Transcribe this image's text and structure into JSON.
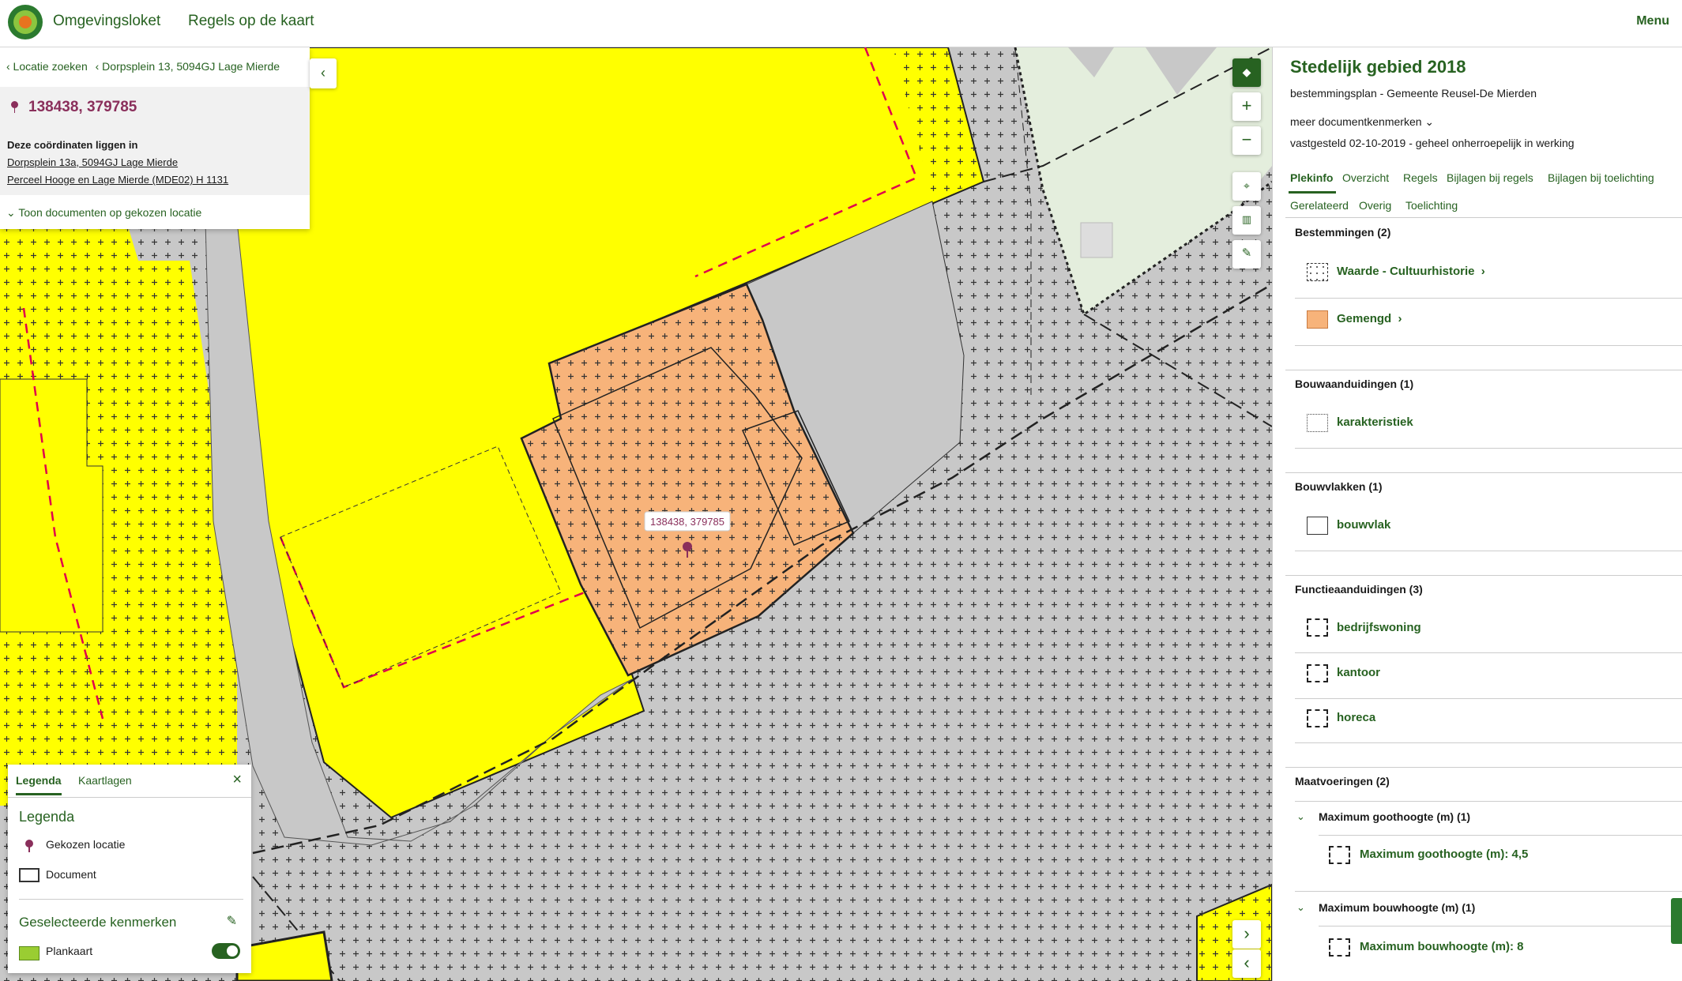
{
  "header": {
    "brand": "Omgevingsloket",
    "title": "Regels op de kaart",
    "menu": "Menu"
  },
  "location": {
    "crumb_search": "‹ Locatie zoeken",
    "crumb_address": "‹ Dorpsplein 13, 5094GJ Lage Mierde",
    "coordinates": "138438, 379785",
    "info_heading": "Deze coördinaten liggen in",
    "address_link": "Dorpsplein 13a, 5094GJ Lage Mierde",
    "parcel_link": "Perceel Hooge en Lage Mierde (MDE02) H 1131",
    "show_documents": "⌄  Toon documenten op gekozen locatie"
  },
  "map": {
    "marker_label": "138438, 379785",
    "colors": {
      "yellow": "#ffff00",
      "grey": "#c8c8c8",
      "orange": "#f7b37a",
      "green": "#e4eedd"
    }
  },
  "legend": {
    "tab_legenda": "Legenda",
    "tab_kaartlagen": "Kaartlagen",
    "heading": "Legenda",
    "item_location": "Gekozen locatie",
    "item_document": "Document",
    "selected_heading": "Geselecteerde kenmerken",
    "item_plankaart": "Plankaart"
  },
  "panel": {
    "title": "Stedelijk gebied 2018",
    "subtitle": "bestemmingsplan - Gemeente Reusel-De Mierden",
    "more": "meer documentkenmerken  ⌄",
    "status": "vastgesteld 02-10-2019 - geheel onherroepelijk in werking",
    "tabs": [
      "Plekinfo",
      "Overzicht",
      "Regels",
      "Bijlagen bij regels",
      "Bijlagen bij toelichting",
      "Gerelateerd",
      "Overig",
      "Toelichting"
    ],
    "sections": {
      "bestemmingen": {
        "heading": "Bestemmingen (2)",
        "items": [
          "Waarde - Cultuurhistorie",
          "Gemengd"
        ]
      },
      "bouwaanduidingen": {
        "heading": "Bouwaanduidingen (1)",
        "items": [
          "karakteristiek"
        ]
      },
      "bouwvlakken": {
        "heading": "Bouwvlakken (1)",
        "items": [
          "bouwvlak"
        ]
      },
      "functieaanduidingen": {
        "heading": "Functieaanduidingen (3)",
        "items": [
          "bedrijfswoning",
          "kantoor",
          "horeca"
        ]
      },
      "maatvoeringen": {
        "heading": "Maatvoeringen (2)",
        "goot_heading": "Maximum goothoogte (m) (1)",
        "goot_item": "Maximum goothoogte (m): 4,5",
        "bouw_heading": "Maximum bouwhoogte (m) (1)",
        "bouw_item": "Maximum bouwhoogte (m): 8"
      }
    }
  }
}
